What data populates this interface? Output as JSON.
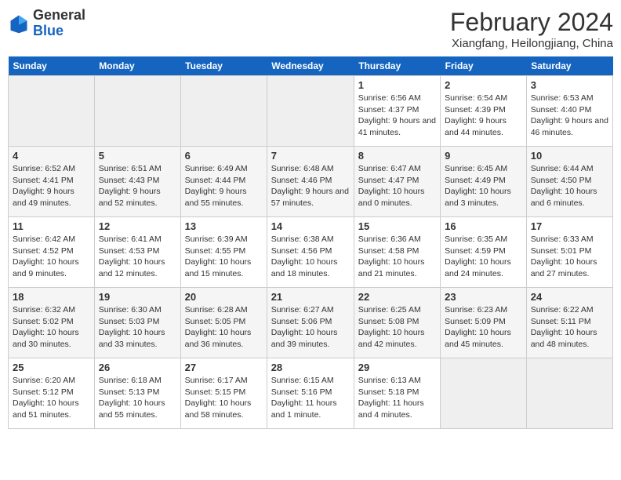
{
  "header": {
    "logo_general": "General",
    "logo_blue": "Blue",
    "month_year": "February 2024",
    "location": "Xiangfang, Heilongjiang, China"
  },
  "days_of_week": [
    "Sunday",
    "Monday",
    "Tuesday",
    "Wednesday",
    "Thursday",
    "Friday",
    "Saturday"
  ],
  "weeks": [
    [
      {
        "day": "",
        "empty": true
      },
      {
        "day": "",
        "empty": true
      },
      {
        "day": "",
        "empty": true
      },
      {
        "day": "",
        "empty": true
      },
      {
        "day": "1",
        "sunrise": "Sunrise: 6:56 AM",
        "sunset": "Sunset: 4:37 PM",
        "daylight": "Daylight: 9 hours and 41 minutes."
      },
      {
        "day": "2",
        "sunrise": "Sunrise: 6:54 AM",
        "sunset": "Sunset: 4:39 PM",
        "daylight": "Daylight: 9 hours and 44 minutes."
      },
      {
        "day": "3",
        "sunrise": "Sunrise: 6:53 AM",
        "sunset": "Sunset: 4:40 PM",
        "daylight": "Daylight: 9 hours and 46 minutes."
      }
    ],
    [
      {
        "day": "4",
        "sunrise": "Sunrise: 6:52 AM",
        "sunset": "Sunset: 4:41 PM",
        "daylight": "Daylight: 9 hours and 49 minutes."
      },
      {
        "day": "5",
        "sunrise": "Sunrise: 6:51 AM",
        "sunset": "Sunset: 4:43 PM",
        "daylight": "Daylight: 9 hours and 52 minutes."
      },
      {
        "day": "6",
        "sunrise": "Sunrise: 6:49 AM",
        "sunset": "Sunset: 4:44 PM",
        "daylight": "Daylight: 9 hours and 55 minutes."
      },
      {
        "day": "7",
        "sunrise": "Sunrise: 6:48 AM",
        "sunset": "Sunset: 4:46 PM",
        "daylight": "Daylight: 9 hours and 57 minutes."
      },
      {
        "day": "8",
        "sunrise": "Sunrise: 6:47 AM",
        "sunset": "Sunset: 4:47 PM",
        "daylight": "Daylight: 10 hours and 0 minutes."
      },
      {
        "day": "9",
        "sunrise": "Sunrise: 6:45 AM",
        "sunset": "Sunset: 4:49 PM",
        "daylight": "Daylight: 10 hours and 3 minutes."
      },
      {
        "day": "10",
        "sunrise": "Sunrise: 6:44 AM",
        "sunset": "Sunset: 4:50 PM",
        "daylight": "Daylight: 10 hours and 6 minutes."
      }
    ],
    [
      {
        "day": "11",
        "sunrise": "Sunrise: 6:42 AM",
        "sunset": "Sunset: 4:52 PM",
        "daylight": "Daylight: 10 hours and 9 minutes."
      },
      {
        "day": "12",
        "sunrise": "Sunrise: 6:41 AM",
        "sunset": "Sunset: 4:53 PM",
        "daylight": "Daylight: 10 hours and 12 minutes."
      },
      {
        "day": "13",
        "sunrise": "Sunrise: 6:39 AM",
        "sunset": "Sunset: 4:55 PM",
        "daylight": "Daylight: 10 hours and 15 minutes."
      },
      {
        "day": "14",
        "sunrise": "Sunrise: 6:38 AM",
        "sunset": "Sunset: 4:56 PM",
        "daylight": "Daylight: 10 hours and 18 minutes."
      },
      {
        "day": "15",
        "sunrise": "Sunrise: 6:36 AM",
        "sunset": "Sunset: 4:58 PM",
        "daylight": "Daylight: 10 hours and 21 minutes."
      },
      {
        "day": "16",
        "sunrise": "Sunrise: 6:35 AM",
        "sunset": "Sunset: 4:59 PM",
        "daylight": "Daylight: 10 hours and 24 minutes."
      },
      {
        "day": "17",
        "sunrise": "Sunrise: 6:33 AM",
        "sunset": "Sunset: 5:01 PM",
        "daylight": "Daylight: 10 hours and 27 minutes."
      }
    ],
    [
      {
        "day": "18",
        "sunrise": "Sunrise: 6:32 AM",
        "sunset": "Sunset: 5:02 PM",
        "daylight": "Daylight: 10 hours and 30 minutes."
      },
      {
        "day": "19",
        "sunrise": "Sunrise: 6:30 AM",
        "sunset": "Sunset: 5:03 PM",
        "daylight": "Daylight: 10 hours and 33 minutes."
      },
      {
        "day": "20",
        "sunrise": "Sunrise: 6:28 AM",
        "sunset": "Sunset: 5:05 PM",
        "daylight": "Daylight: 10 hours and 36 minutes."
      },
      {
        "day": "21",
        "sunrise": "Sunrise: 6:27 AM",
        "sunset": "Sunset: 5:06 PM",
        "daylight": "Daylight: 10 hours and 39 minutes."
      },
      {
        "day": "22",
        "sunrise": "Sunrise: 6:25 AM",
        "sunset": "Sunset: 5:08 PM",
        "daylight": "Daylight: 10 hours and 42 minutes."
      },
      {
        "day": "23",
        "sunrise": "Sunrise: 6:23 AM",
        "sunset": "Sunset: 5:09 PM",
        "daylight": "Daylight: 10 hours and 45 minutes."
      },
      {
        "day": "24",
        "sunrise": "Sunrise: 6:22 AM",
        "sunset": "Sunset: 5:11 PM",
        "daylight": "Daylight: 10 hours and 48 minutes."
      }
    ],
    [
      {
        "day": "25",
        "sunrise": "Sunrise: 6:20 AM",
        "sunset": "Sunset: 5:12 PM",
        "daylight": "Daylight: 10 hours and 51 minutes."
      },
      {
        "day": "26",
        "sunrise": "Sunrise: 6:18 AM",
        "sunset": "Sunset: 5:13 PM",
        "daylight": "Daylight: 10 hours and 55 minutes."
      },
      {
        "day": "27",
        "sunrise": "Sunrise: 6:17 AM",
        "sunset": "Sunset: 5:15 PM",
        "daylight": "Daylight: 10 hours and 58 minutes."
      },
      {
        "day": "28",
        "sunrise": "Sunrise: 6:15 AM",
        "sunset": "Sunset: 5:16 PM",
        "daylight": "Daylight: 11 hours and 1 minute."
      },
      {
        "day": "29",
        "sunrise": "Sunrise: 6:13 AM",
        "sunset": "Sunset: 5:18 PM",
        "daylight": "Daylight: 11 hours and 4 minutes."
      },
      {
        "day": "",
        "empty": true
      },
      {
        "day": "",
        "empty": true
      }
    ]
  ]
}
